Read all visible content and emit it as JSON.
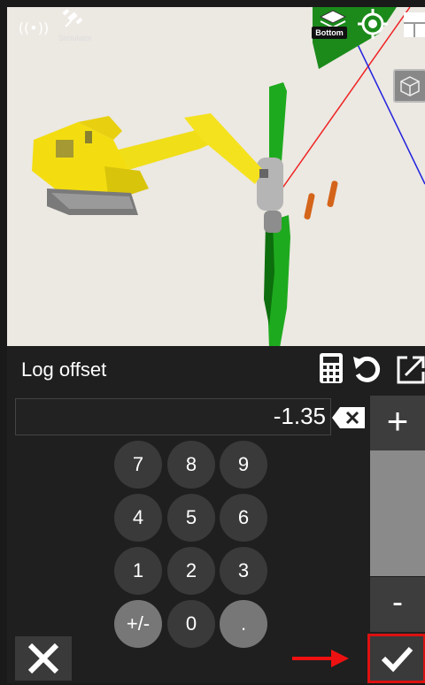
{
  "hud": {
    "signal_icon": "signal-broadcast-icon",
    "satellite_icon": "satellite-icon",
    "simulator_label": "Simulator",
    "layers_icon": "layers-icon",
    "layers_badge": "Bottom",
    "locate_icon": "crosshair-icon",
    "view_cube_icon": "view-cube-icon"
  },
  "panel": {
    "title": "Log offset",
    "calculator_icon": "calculator-icon",
    "reset_icon": "undo-icon",
    "popout_icon": "open-external-icon",
    "value": "-1.35",
    "backspace_icon": "backspace-icon",
    "keys": [
      "7",
      "8",
      "9",
      "4",
      "5",
      "6",
      "1",
      "2",
      "3",
      "+/-",
      "0",
      "."
    ],
    "plus_label": "+",
    "minus_label": "-",
    "cancel_icon": "close-icon",
    "confirm_icon": "checkmark-icon"
  },
  "colors": {
    "accent_red": "#dd1111",
    "panel_bg": "#1f1f1f",
    "key_bg": "#3a3a3a",
    "key_alt": "#777777"
  }
}
